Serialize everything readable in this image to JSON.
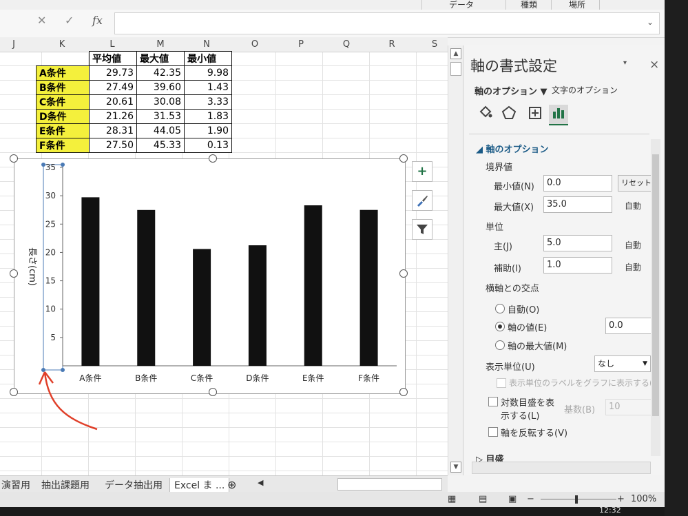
{
  "ribbon": {
    "labels": [
      "データ",
      "種類",
      "場所"
    ]
  },
  "formula_bar": {
    "cancel": "✕",
    "enter": "✓",
    "fx": "fx",
    "value": ""
  },
  "columns": [
    "J",
    "K",
    "L",
    "M",
    "N",
    "O",
    "P",
    "Q",
    "R",
    "S"
  ],
  "table": {
    "headers": [
      "平均値",
      "最大値",
      "最小値"
    ],
    "rows": [
      {
        "label": "A条件",
        "avg": "29.73",
        "max": "42.35",
        "min": "9.98"
      },
      {
        "label": "B条件",
        "avg": "27.49",
        "max": "39.60",
        "min": "1.43"
      },
      {
        "label": "C条件",
        "avg": "20.61",
        "max": "30.08",
        "min": "3.33"
      },
      {
        "label": "D条件",
        "avg": "21.26",
        "max": "31.53",
        "min": "1.83"
      },
      {
        "label": "E条件",
        "avg": "28.31",
        "max": "44.05",
        "min": "1.90"
      },
      {
        "label": "F条件",
        "avg": "27.50",
        "max": "45.33",
        "min": "0.13"
      }
    ]
  },
  "chart_data": {
    "type": "bar",
    "categories": [
      "A条件",
      "B条件",
      "C条件",
      "D条件",
      "E条件",
      "F条件"
    ],
    "values": [
      29.73,
      27.49,
      20.61,
      21.26,
      28.31,
      27.5
    ],
    "ylabel": "長さ(cm)",
    "ylim": [
      0,
      35
    ],
    "yticks": [
      "5",
      "10",
      "15",
      "20",
      "25",
      "30",
      "35"
    ],
    "bar_color": "#111111",
    "grid": false,
    "legend": false
  },
  "chart_buttons": {
    "add": "+",
    "style": "brush-icon",
    "filter": "filter-icon"
  },
  "sheet_tabs": [
    "演習用",
    "抽出課題用",
    "データ抽出用",
    "Excel ま ..."
  ],
  "status": {
    "zoom": "100%",
    "time": "12:32"
  },
  "pane": {
    "title": "軸の書式設定",
    "close": "×",
    "tab_axis_options": "軸のオプション ▼",
    "tab_text_options": "文字のオプション",
    "section_axis": "軸のオプション",
    "bounds_label": "境界値",
    "min_label": "最小値(N)",
    "min_value": "0.0",
    "reset": "リセット",
    "max_label": "最大値(X)",
    "max_value": "35.0",
    "auto": "自動",
    "units_label": "単位",
    "major_label": "主(J)",
    "major_value": "5.0",
    "minor_label": "補助(I)",
    "minor_value": "1.0",
    "cross_label": "横軸との交点",
    "radio_auto": "自動(O)",
    "radio_value": "軸の値(E)",
    "radio_value_input": "0.0",
    "radio_max": "軸の最大値(M)",
    "display_unit_label": "表示単位(U)",
    "display_unit_value": "なし",
    "show_unit_label": "表示単位のラベルをグラフに表示する(S)",
    "log_scale": "対数目盛を表",
    "log_scale2": "示する(L)",
    "base_label": "基数(B)",
    "base_value": "10",
    "reverse": "軸を反転する(V)",
    "section_ticks": "目盛"
  }
}
